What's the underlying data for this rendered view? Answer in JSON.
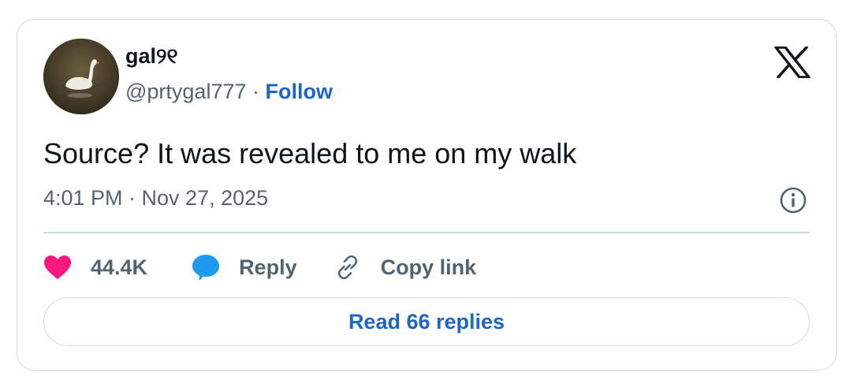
{
  "author": {
    "display_name": "gal୨୧",
    "handle": "@prtygal777",
    "separator": "·",
    "follow_label": "Follow",
    "avatar_icon": "swan-avatar"
  },
  "brand": {
    "logo": "x-logo-icon"
  },
  "tweet": {
    "text": "Source? It was revealed to me on my walk",
    "timestamp": "4:01 PM · Nov 27, 2025"
  },
  "actions": {
    "likes": "44.4K",
    "reply_label": "Reply",
    "copy_link_label": "Copy link"
  },
  "read_replies_label": "Read 66 replies",
  "colors": {
    "like": "#f91880",
    "reply": "#1d9bf0",
    "link": "#1d65c9",
    "muted": "#536471",
    "border": "#cfd9de"
  }
}
